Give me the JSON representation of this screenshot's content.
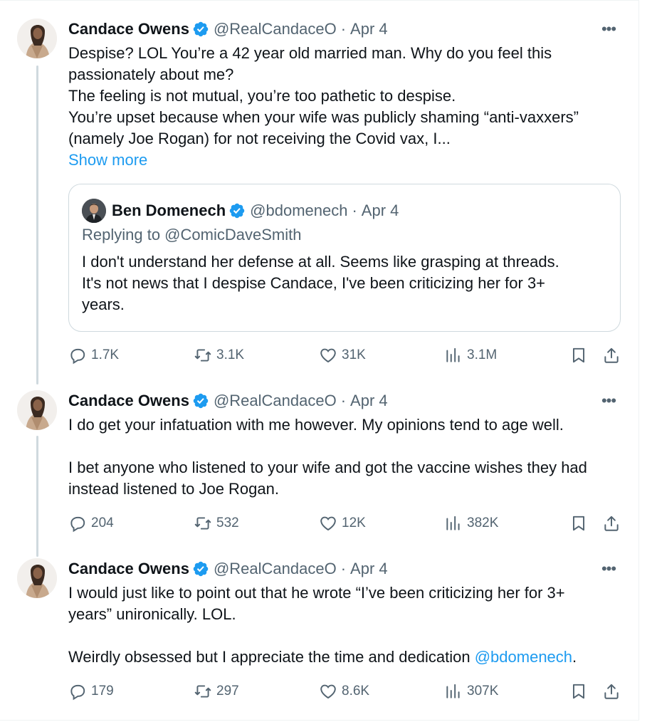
{
  "tweets": [
    {
      "author": {
        "name": "Candace Owens",
        "handle": "@RealCandaceO",
        "date": "Apr 4"
      },
      "text_lines": [
        "Despise? LOL You’re a 42 year old married man. Why do you feel this",
        "passionately about me?",
        "The feeling is not mutual, you’re too pathetic to despise.",
        "You’re upset because when your wife was publicly shaming “anti-vaxxers”",
        "(namely Joe Rogan) for not receiving the Covid vax, I..."
      ],
      "show_more": "Show more",
      "quote": {
        "name": "Ben Domenech",
        "handle": "@bdomenech",
        "date": "Apr 4",
        "replying_to": "Replying to @ComicDaveSmith",
        "text_lines": [
          "I don't understand her defense at all. Seems like grasping at threads.",
          "It's not news that I despise Candace, I've been criticizing her for 3+",
          "years."
        ]
      },
      "metrics": {
        "replies": "1.7K",
        "retweets": "3.1K",
        "likes": "31K",
        "views": "3.1M"
      }
    },
    {
      "author": {
        "name": "Candace Owens",
        "handle": "@RealCandaceO",
        "date": "Apr 4"
      },
      "text_lines": [
        "I do get your infatuation with me however. My opinions tend to age well.",
        "",
        "I bet anyone who listened to your wife and got the vaccine wishes they had",
        "instead listened to Joe Rogan."
      ],
      "metrics": {
        "replies": "204",
        "retweets": "532",
        "likes": "12K",
        "views": "382K"
      }
    },
    {
      "author": {
        "name": "Candace Owens",
        "handle": "@RealCandaceO",
        "date": "Apr 4"
      },
      "text_lines": [
        "I would just like to point out that he wrote “I’ve been criticizing her for 3+",
        "years” unironically. LOL.",
        ""
      ],
      "text_last_prefix": "Weirdly obsessed but I appreciate the time and dedication ",
      "text_last_mention": "@bdomenech",
      "text_last_suffix": ".",
      "metrics": {
        "replies": "179",
        "retweets": "297",
        "likes": "8.6K",
        "views": "307K"
      }
    }
  ],
  "separator_dot": "·",
  "more_glyph": "•••",
  "colors": {
    "link": "#1d9bf0",
    "muted": "#536471",
    "thread_line": "#cfd9de",
    "verified": "#1d9bf0"
  },
  "icons": [
    "verified-badge-icon",
    "more-options-icon",
    "reply-icon",
    "retweet-icon",
    "like-icon",
    "views-icon",
    "bookmark-icon",
    "share-icon"
  ]
}
